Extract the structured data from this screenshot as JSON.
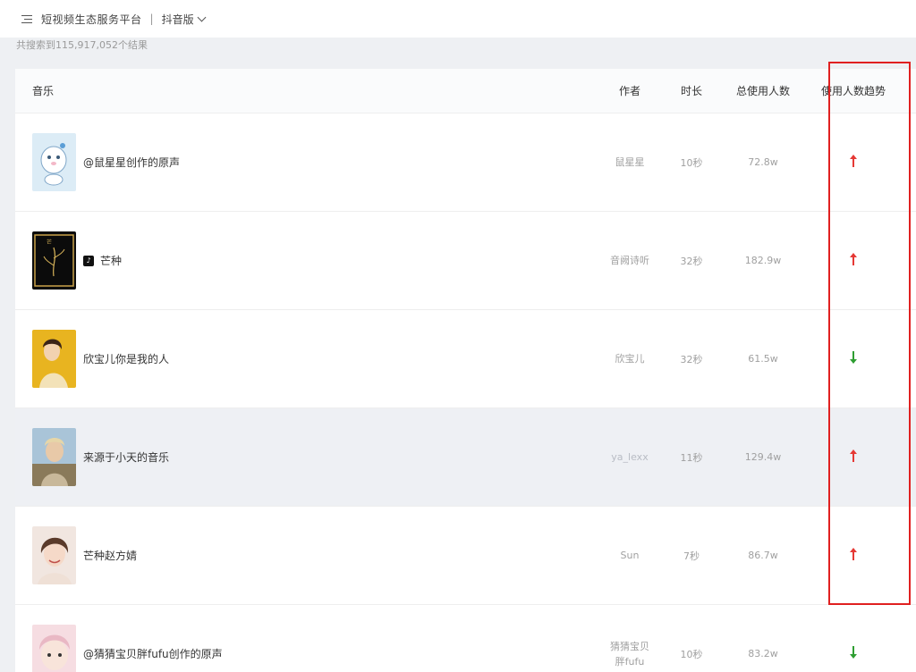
{
  "topbar": {
    "menu_icon": "menu-icon",
    "platform_title": "短视频生态服务平台",
    "separator": "|",
    "version": "抖音版",
    "version_icon": "chevron-down-icon"
  },
  "result_count": "共搜索到115,917,052个结果",
  "table": {
    "headers": {
      "music": "音乐",
      "author": "作者",
      "duration": "时长",
      "total_users": "总使用人数",
      "trend": "使用人数趋势"
    },
    "rows": [
      {
        "title": "@鼠星星创作的原声",
        "author": "鼠星星",
        "duration": "10秒",
        "users": "72.8w",
        "trend": "up"
      },
      {
        "title": "芒种",
        "author": "音阙诗听",
        "duration": "32秒",
        "users": "182.9w",
        "trend": "up",
        "badge": "tiktok-icon"
      },
      {
        "title": "欣宝儿你是我的人",
        "author": "欣宝儿",
        "duration": "32秒",
        "users": "61.5w",
        "trend": "down"
      },
      {
        "title": "来源于小天的音乐",
        "author": "ya_lexx",
        "duration": "11秒",
        "users": "129.4w",
        "trend": "up"
      },
      {
        "title": "芒种赵方婧",
        "author": "Sun",
        "duration": "7秒",
        "users": "86.7w",
        "trend": "up"
      },
      {
        "title": "@猜猜宝贝胖fufu创作的原声",
        "author": "猜猜宝贝\n胖fufu",
        "duration": "10秒",
        "users": "83.2w",
        "trend": "down"
      }
    ]
  },
  "colors": {
    "trend_up": "#e53935",
    "trend_down": "#2e9e32",
    "highlight": "#e02020"
  }
}
